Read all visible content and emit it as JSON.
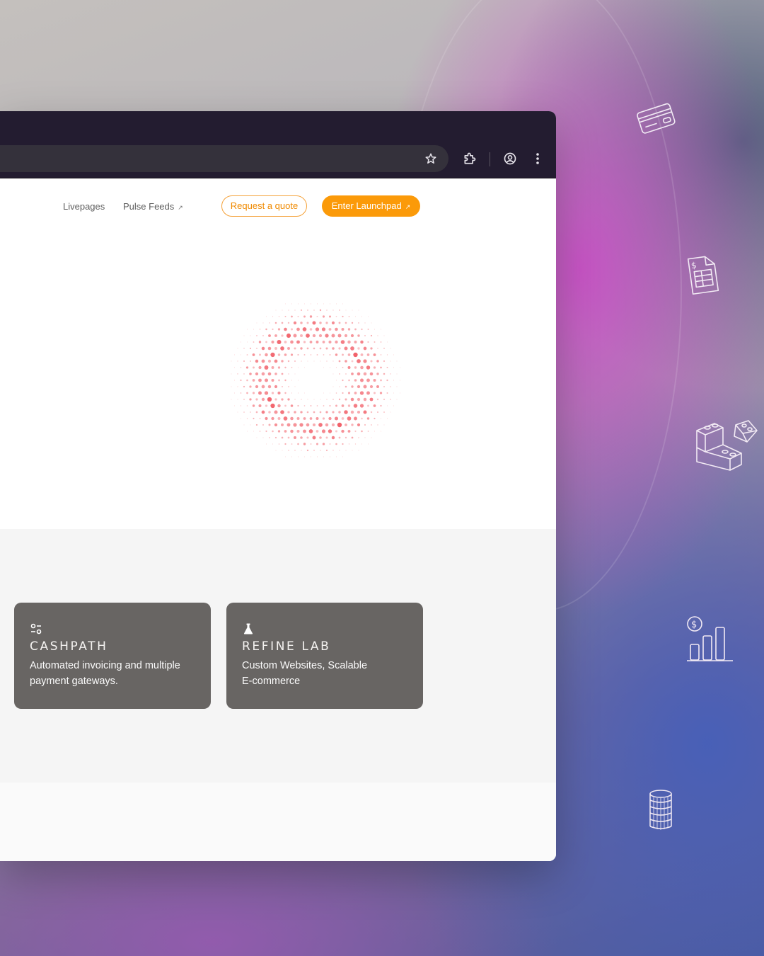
{
  "nav": {
    "links": [
      {
        "label": "Livepages"
      },
      {
        "label": "Pulse Feeds",
        "arrow": "↗"
      }
    ],
    "request_quote": "Request a quote",
    "enter_launchpad": "Enter Launchpad",
    "launchpad_arrow": "↗"
  },
  "browser": {
    "toolbar_icons": [
      "star-icon",
      "puzzle-icon",
      "account-icon",
      "kebab-menu-icon"
    ]
  },
  "features": {
    "cards": [
      {
        "icon": "toggle-settings-icon",
        "title": "CASHPATH",
        "line1": "Automated invoicing and multiple",
        "line2": "payment gateways."
      },
      {
        "icon": "flask-icon",
        "title": "REFINE LAB",
        "line1": "Custom Websites, Scalable",
        "line2": "E-commerce"
      }
    ]
  },
  "decor_icons": [
    "credit-card-icon",
    "spreadsheet-dollar-icon",
    "building-blocks-icon",
    "chart-dollar-icon",
    "coin-stack-icon"
  ],
  "colors": {
    "accent_orange": "#fb9a09",
    "card_bg": "#686563",
    "browser_chrome": "#231c30",
    "dot_red": "#f0505a"
  }
}
